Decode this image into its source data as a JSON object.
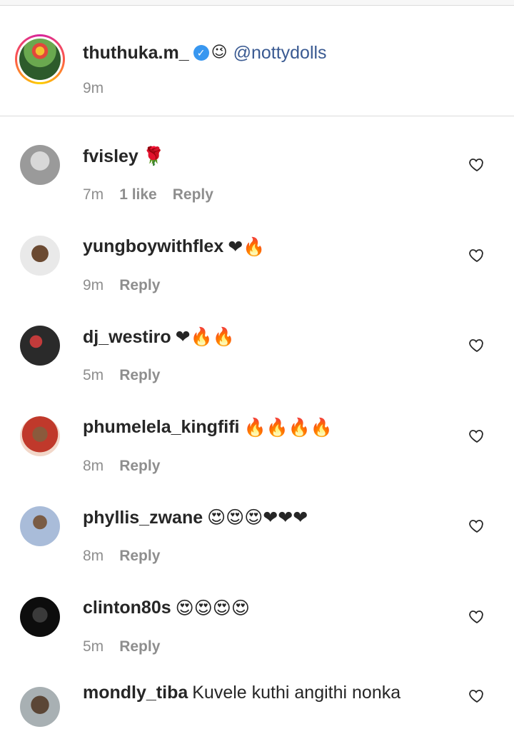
{
  "caption": {
    "username": "thuthuka.m_",
    "verified_icon": "verified-badge-icon",
    "emoji": "😉",
    "mention": "@nottydolls",
    "time": "9m"
  },
  "comments": [
    {
      "username": "fvisley",
      "text": "🌹",
      "time": "7m",
      "likes": "1 like",
      "reply": "Reply",
      "avatar_color": "#b8b8b8"
    },
    {
      "username": "yungboywithflex",
      "text": "❤🔥",
      "time": "9m",
      "reply": "Reply",
      "avatar_color": "#c9a27a"
    },
    {
      "username": "dj_westiro",
      "text": "❤🔥🔥",
      "time": "5m",
      "reply": "Reply",
      "avatar_color": "#3a3a3a"
    },
    {
      "username": "phumelela_kingfifi",
      "text": "🔥🔥🔥🔥",
      "time": "8m",
      "reply": "Reply",
      "avatar_color": "#b9433f"
    },
    {
      "username": "phyllis_zwane",
      "text": "😍😍😍❤❤❤",
      "time": "8m",
      "reply": "Reply",
      "avatar_color": "#8fa3c7"
    },
    {
      "username": "clinton80s",
      "text": "😍😍😍😍",
      "time": "5m",
      "reply": "Reply",
      "avatar_color": "#111111"
    },
    {
      "username": "mondly_tiba",
      "text": "Kuvele kuthi angithi nonka",
      "time": "",
      "reply": "",
      "avatar_color": "#6b5a4a"
    }
  ],
  "icons": {
    "like": "heart-outline-icon"
  }
}
